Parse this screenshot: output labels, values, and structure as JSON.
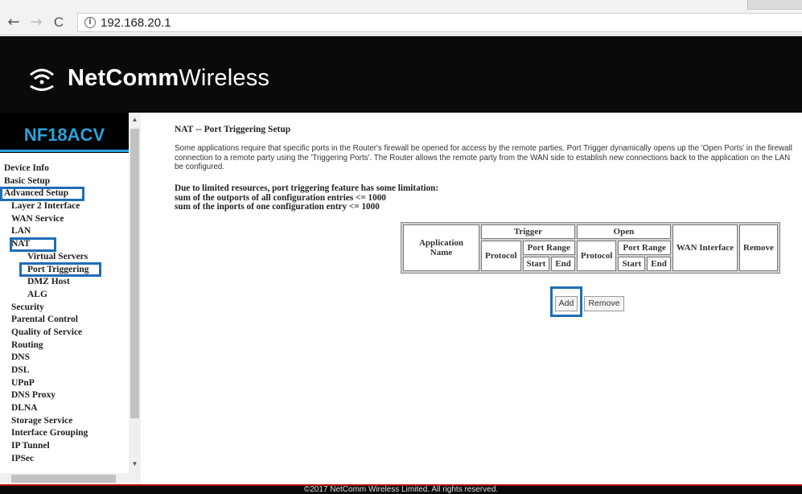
{
  "browser": {
    "back_icon": "←",
    "forward_icon": "→",
    "reload_icon": "C",
    "info_icon": "i",
    "url": "192.168.20.1"
  },
  "header": {
    "logo_strong": "NetComm",
    "logo_light": "Wireless"
  },
  "sidebar": {
    "model": "NF18ACV",
    "items": [
      {
        "label": "Device Info",
        "level": 0
      },
      {
        "label": "Basic Setup",
        "level": 0
      },
      {
        "label": "Advanced Setup",
        "level": 0
      },
      {
        "label": "Layer 2 Interface",
        "level": 1
      },
      {
        "label": "WAN Service",
        "level": 1
      },
      {
        "label": "LAN",
        "level": 1
      },
      {
        "label": "NAT",
        "level": 1
      },
      {
        "label": "Virtual Servers",
        "level": 3
      },
      {
        "label": "Port Triggering",
        "level": 3
      },
      {
        "label": "DMZ Host",
        "level": 3
      },
      {
        "label": "ALG",
        "level": 3
      },
      {
        "label": "Security",
        "level": 1
      },
      {
        "label": "Parental Control",
        "level": 1
      },
      {
        "label": "Quality of Service",
        "level": 1
      },
      {
        "label": "Routing",
        "level": 1
      },
      {
        "label": "DNS",
        "level": 1
      },
      {
        "label": "DSL",
        "level": 1
      },
      {
        "label": "UPnP",
        "level": 1
      },
      {
        "label": "DNS Proxy",
        "level": 1
      },
      {
        "label": "DLNA",
        "level": 1
      },
      {
        "label": "Storage Service",
        "level": 1
      },
      {
        "label": "Interface Grouping",
        "level": 1
      },
      {
        "label": "IP Tunnel",
        "level": 1
      },
      {
        "label": "IPSec",
        "level": 1
      }
    ]
  },
  "main": {
    "title": "NAT -- Port Triggering Setup",
    "desc_line1": "Some applications require that specific ports in the Router's firewall be opened for access by the remote parties. Port Trigger dynamically opens up the 'Open Ports' in the firewall",
    "desc_line2": "connection to a remote party using the 'Triggering Ports'. The Router allows the remote party from the WAN side to establish new connections back to the application on the LAN",
    "desc_line3": "be configured.",
    "limit_line1": "Due to limited resources, port triggering feature has some limitation:",
    "limit_line2": "sum of the outports of all configuration entries <= 1000",
    "limit_line3": "sum of the inports of one configuration entry <= 1000"
  },
  "table": {
    "application_name": "Application Name",
    "trigger": "Trigger",
    "open": "Open",
    "protocol": "Protocol",
    "port_range": "Port Range",
    "start": "Start",
    "end": "End",
    "wan_interface": "WAN Interface",
    "remove": "Remove"
  },
  "buttons": {
    "add": "Add",
    "remove": "Remove"
  },
  "footer": {
    "copyright": "©2017 NetComm Wireless Limited. All rights reserved."
  },
  "colors": {
    "highlight": "#1f6db5",
    "brand_blue": "#2aa3dd",
    "footer_line": "#b00000"
  }
}
